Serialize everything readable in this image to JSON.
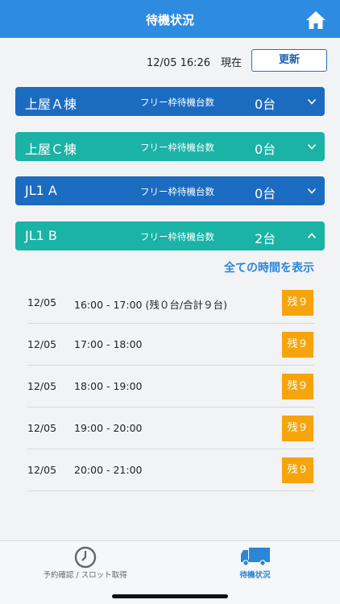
{
  "header": {
    "title": "待機状況"
  },
  "status": {
    "timestamp": "12/05 16:26　現在",
    "refresh_label": "更新"
  },
  "sections": [
    {
      "name": "上屋Ａ棟",
      "label": "フリー枠待機台数",
      "count": "0台",
      "color": "#1b6cc1",
      "expanded": false
    },
    {
      "name": "上屋Ｃ棟",
      "label": "フリー枠待機台数",
      "count": "0台",
      "color": "#1ab3a6",
      "expanded": false
    },
    {
      "name": "JL1 A",
      "label": "フリー枠待機台数",
      "count": "0台",
      "color": "#1b6cc1",
      "expanded": false
    },
    {
      "name": "JL1 B",
      "label": "フリー枠待機台数",
      "count": "2台",
      "color": "#1ab3a6",
      "expanded": true
    }
  ],
  "show_all_label": "全ての時間を表示",
  "slots": [
    {
      "date": "12/05",
      "time": "16:00 - 17:00  (残０台/合計９台)",
      "badge": "残９"
    },
    {
      "date": "12/05",
      "time": "17:00 - 18:00",
      "badge": "残９"
    },
    {
      "date": "12/05",
      "time": "18:00 - 19:00",
      "badge": "残９"
    },
    {
      "date": "12/05",
      "time": "19:00 - 20:00",
      "badge": "残９"
    },
    {
      "date": "12/05",
      "time": "20:00 - 21:00",
      "badge": "残９"
    }
  ],
  "tabs": [
    {
      "label": "予約確認 / スロット取得",
      "icon": "clock-icon",
      "active": false
    },
    {
      "label": "待機状況",
      "icon": "truck-icon",
      "active": true
    }
  ],
  "colors": {
    "header": "#2d8be0",
    "badge": "#f6a40b",
    "link": "#2b86d8"
  }
}
